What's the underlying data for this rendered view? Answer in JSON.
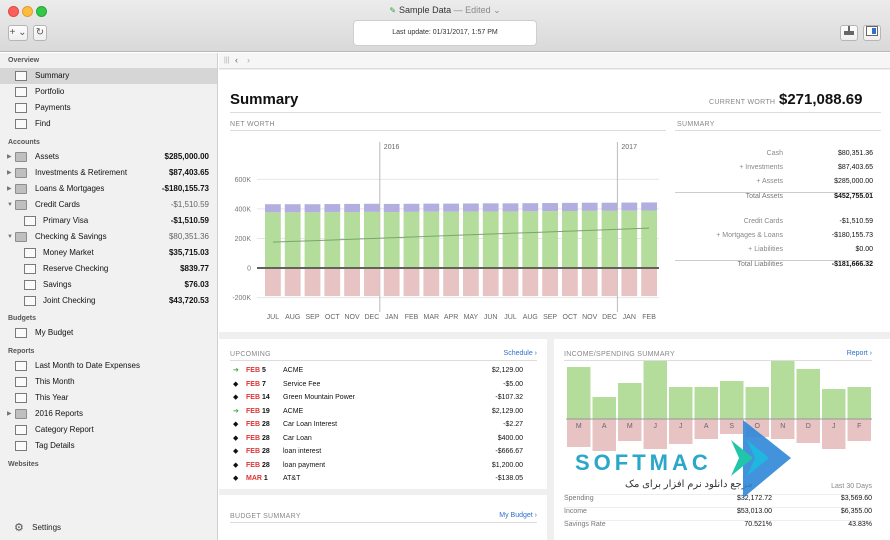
{
  "window": {
    "title": "Sample Data",
    "edited": "— Edited ⌄",
    "last_update": "Last update:  01/31/2017, 1:57 PM",
    "add_button": "+ ⌄",
    "refresh_button": "↻"
  },
  "sidebar": {
    "overview_label": "Overview",
    "overview_items": [
      {
        "label": "Summary",
        "icon": "bank-icon"
      },
      {
        "label": "Portfolio",
        "icon": "chart-icon"
      },
      {
        "label": "Payments",
        "icon": "people-icon"
      },
      {
        "label": "Find",
        "icon": "magnifier-icon"
      }
    ],
    "accounts_label": "Accounts",
    "accounts": [
      {
        "label": "Assets",
        "amount": "$285,000.00"
      },
      {
        "label": "Investments & Retirement",
        "amount": "$87,403.65"
      },
      {
        "label": "Loans & Mortgages",
        "amount": "-$180,155.73"
      },
      {
        "label": "Credit Cards",
        "amount": "-$1,510.59"
      },
      {
        "label": "Primary Visa",
        "amount": "-$1,510.59"
      },
      {
        "label": "Checking & Savings",
        "amount": "$80,351.36"
      },
      {
        "label": "Money Market",
        "amount": "$35,715.03"
      },
      {
        "label": "Reserve Checking",
        "amount": "$839.77"
      },
      {
        "label": "Savings",
        "amount": "$76.03"
      },
      {
        "label": "Joint Checking",
        "amount": "$43,720.53"
      }
    ],
    "budgets_label": "Budgets",
    "budgets": [
      {
        "label": "My Budget"
      }
    ],
    "reports_label": "Reports",
    "reports": [
      {
        "label": "Last Month to Date Expenses"
      },
      {
        "label": "This Month"
      },
      {
        "label": "This Year"
      },
      {
        "label": "2016 Reports"
      },
      {
        "label": "Category Report"
      },
      {
        "label": "Tag Details"
      }
    ],
    "websites_label": "Websites",
    "settings_label": "Settings"
  },
  "main": {
    "title": "Summary",
    "current_worth_label": "CURRENT WORTH",
    "current_worth": "$271,088.69"
  },
  "net_worth": {
    "section_label": "NET WORTH",
    "year_markers": [
      "2016",
      "2017"
    ]
  },
  "chart_data": {
    "type": "bar",
    "title": "NET WORTH",
    "categories": [
      "JUL",
      "AUG",
      "SEP",
      "OCT",
      "NOV",
      "DEC",
      "JAN",
      "FEB",
      "MAR",
      "APR",
      "MAY",
      "JUN",
      "JUL",
      "AUG",
      "SEP",
      "OCT",
      "NOV",
      "DEC",
      "JAN",
      "FEB"
    ],
    "series": [
      {
        "values": [
          377,
          377,
          377,
          378,
          379,
          380,
          379,
          380,
          381,
          381,
          382,
          383,
          383,
          384,
          385,
          386,
          387,
          387,
          388,
          389
        ]
      },
      {
        "values": [
          55,
          55,
          55,
          55,
          55,
          55,
          55,
          55,
          55,
          55,
          55,
          55,
          55,
          55,
          55,
          55,
          55,
          55,
          55,
          55
        ]
      },
      {
        "values": [
          -190,
          -190,
          -190,
          -190,
          -190,
          -190,
          -190,
          -190,
          -190,
          -190,
          -190,
          -190,
          -190,
          -190,
          -190,
          -190,
          -190,
          -190,
          -190,
          -190
        ]
      },
      {
        "type": "line",
        "values": [
          175,
          180,
          185,
          190,
          195,
          200,
          205,
          210,
          215,
          220,
          225,
          230,
          235,
          240,
          245,
          250,
          255,
          260,
          265,
          270
        ]
      }
    ],
    "yticks": [
      "600K",
      "400K",
      "200K",
      "0",
      "-200K"
    ],
    "ylim": [
      -230,
      650
    ],
    "colors": {
      "assets": "#b4dc9b",
      "investments": "#b3aee0",
      "liabilities": "#e8c3c3",
      "line": "#7aa66d"
    },
    "grid": true
  },
  "summary": {
    "section_label": "SUMMARY",
    "rows": [
      {
        "label": "Cash",
        "value": "$80,351.36",
        "total": false
      },
      {
        "label": "+ Investments",
        "value": "$87,403.65",
        "total": false
      },
      {
        "label": "+ Assets",
        "value": "$285,000.00",
        "total": false
      },
      {
        "label": "Total Assets",
        "value": "$452,755.01",
        "total": true
      },
      {
        "label": "Credit Cards",
        "value": "-$1,510.59",
        "total": false
      },
      {
        "label": "+ Mortgages & Loans",
        "value": "-$180,155.73",
        "total": false
      },
      {
        "label": "+ Liabilities",
        "value": "$0.00",
        "total": false
      },
      {
        "label": "Total Liabilities",
        "value": "-$181,666.32",
        "total": true
      }
    ]
  },
  "upcoming": {
    "section_label": "UPCOMING",
    "link": "Schedule ›",
    "rows": [
      {
        "arrow": "➔",
        "arrow_color": "#3aa83a",
        "month": "FEB",
        "day": "5",
        "payee": "ACME",
        "amount": "$2,129.00"
      },
      {
        "arrow": "◆",
        "arrow_color": "#111111",
        "month": "FEB",
        "day": "7",
        "payee": "Service Fee",
        "amount": "-$5.00"
      },
      {
        "arrow": "◆",
        "arrow_color": "#111111",
        "month": "FEB",
        "day": "14",
        "payee": "Green Mountain Power",
        "amount": "-$107.32"
      },
      {
        "arrow": "➔",
        "arrow_color": "#3aa83a",
        "month": "FEB",
        "day": "19",
        "payee": "ACME",
        "amount": "$2,129.00"
      },
      {
        "arrow": "◆",
        "arrow_color": "#111111",
        "month": "FEB",
        "day": "28",
        "payee": "Car Loan Interest",
        "amount": "-$2.27"
      },
      {
        "arrow": "◆",
        "arrow_color": "#111111",
        "month": "FEB",
        "day": "28",
        "payee": "Car Loan",
        "amount": "$400.00"
      },
      {
        "arrow": "◆",
        "arrow_color": "#111111",
        "month": "FEB",
        "day": "28",
        "payee": "loan interest",
        "amount": "-$666.67"
      },
      {
        "arrow": "◆",
        "arrow_color": "#111111",
        "month": "FEB",
        "day": "28",
        "payee": "loan payment",
        "amount": "$1,200.00"
      },
      {
        "arrow": "◆",
        "arrow_color": "#111111",
        "month": "MAR",
        "day": "1",
        "payee": "AT&T",
        "amount": "-$138.05"
      }
    ]
  },
  "budget_summary": {
    "section_label": "BUDGET SUMMARY",
    "link": "My Budget ›"
  },
  "income_spending": {
    "section_label": "INCOME/SPENDING SUMMARY",
    "link": "Report ›",
    "month_letters": [
      "M",
      "A",
      "M",
      "J",
      "J",
      "A",
      "S",
      "O",
      "N",
      "D",
      "J",
      "F"
    ],
    "income_bars": [
      52,
      22,
      36,
      58,
      32,
      32,
      38,
      32,
      58,
      50,
      30,
      32
    ],
    "spending_bars": [
      28,
      32,
      22,
      30,
      25,
      20,
      15,
      18,
      20,
      24,
      30,
      22
    ],
    "period_label": "Last 30 Days",
    "rows": [
      {
        "label": "Spending",
        "value_a": "$32,172.72",
        "value_b": "$3,569.60"
      },
      {
        "label": "Income",
        "value_a": "$53,013.00",
        "value_b": "$6,355.00"
      },
      {
        "label": "Savings Rate",
        "value_a": "70.521%",
        "value_b": "43.83%"
      }
    ]
  },
  "watermark": {
    "name": "SOFTMAC",
    "tagline": "مرجع دانلود نرم افزار برای مک"
  }
}
